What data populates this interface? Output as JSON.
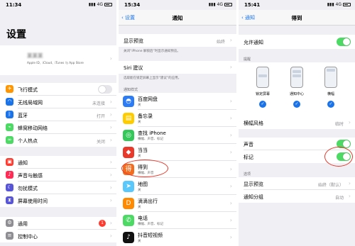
{
  "panel1": {
    "time": "11:34",
    "network": "4G",
    "title": "设置",
    "profile": {
      "name": "某某某",
      "sub": "Apple ID、iCloud、iTunes 与 App Store"
    },
    "rows": [
      {
        "label": "飞行模式",
        "value": "",
        "color": "#ff9500",
        "glyph": "✈"
      },
      {
        "label": "无线局域网",
        "value": "未连接",
        "color": "#1a73e8",
        "glyph": "◠"
      },
      {
        "label": "蓝牙",
        "value": "打开",
        "color": "#1a73e8",
        "glyph": "ᛒ"
      },
      {
        "label": "蜂窝移动网络",
        "value": "",
        "color": "#4cd964",
        "glyph": "⌁"
      },
      {
        "label": "个人热点",
        "value": "关闭",
        "color": "#4cd964",
        "glyph": "∞"
      },
      {
        "label": "通知",
        "value": "",
        "color": "#ff3b30",
        "glyph": "▣"
      },
      {
        "label": "声音与触感",
        "value": "",
        "color": "#ff2d55",
        "glyph": "♪"
      },
      {
        "label": "勿扰模式",
        "value": "",
        "color": "#5856d6",
        "glyph": "☾"
      },
      {
        "label": "屏幕使用时间",
        "value": "",
        "color": "#5856d6",
        "glyph": "⧗"
      },
      {
        "label": "通用",
        "value": "",
        "color": "#8e8e93",
        "glyph": "⚙"
      },
      {
        "label": "控制中心",
        "value": "",
        "color": "#8e8e93",
        "glyph": "≡"
      }
    ],
    "badge": "1"
  },
  "panel2": {
    "time": "15:34",
    "network": "4G",
    "back": "设置",
    "title": "通知",
    "preview_label": "显示预览",
    "preview_value": "始终",
    "preview_note": "关闭“iPhone 解锁后”时显示通知预览。",
    "siri_label": "Siri 建议",
    "siri_note": "选取能在锁定屏幕上显示“建议”的应用。",
    "section": "通知样式",
    "apps": [
      {
        "name": "百度网盘",
        "sub": "关",
        "color": "#2c7cf6",
        "glyph": "◓"
      },
      {
        "name": "备忘录",
        "sub": "关",
        "color": "#ffcc00",
        "glyph": "▤"
      },
      {
        "name": "查找 iPhone",
        "sub": "横幅、声音、标记",
        "color": "#34c759",
        "glyph": "◎"
      },
      {
        "name": "当当",
        "sub": "关",
        "color": "#e8392b",
        "glyph": "◆"
      },
      {
        "name": "得到",
        "sub": "横幅、声音",
        "color": "#f26d1f",
        "glyph": "得"
      },
      {
        "name": "地图",
        "sub": "关",
        "color": "#5ac8fa",
        "glyph": "➤"
      },
      {
        "name": "滴滴出行",
        "sub": "关",
        "color": "#ff8a00",
        "glyph": "D"
      },
      {
        "name": "电话",
        "sub": "横幅、声音、标记",
        "color": "#4cd964",
        "glyph": "✆"
      },
      {
        "name": "抖音短视频",
        "sub": "关",
        "color": "#111111",
        "glyph": "♪"
      }
    ]
  },
  "panel3": {
    "time": "15:41",
    "network": "4G",
    "back": "通知",
    "title": "得到",
    "allow_label": "允许通知",
    "alerts_header": "提醒",
    "phones": [
      "锁定屏幕",
      "通知中心",
      "横幅"
    ],
    "banner_label": "横幅风格",
    "banner_value": "临时",
    "sound_label": "声音",
    "badge_label": "标记",
    "options_header": "选项",
    "preview_label": "显示预览",
    "preview_value": "始终（默认）",
    "group_label": "通知分组",
    "group_value": "自动"
  }
}
